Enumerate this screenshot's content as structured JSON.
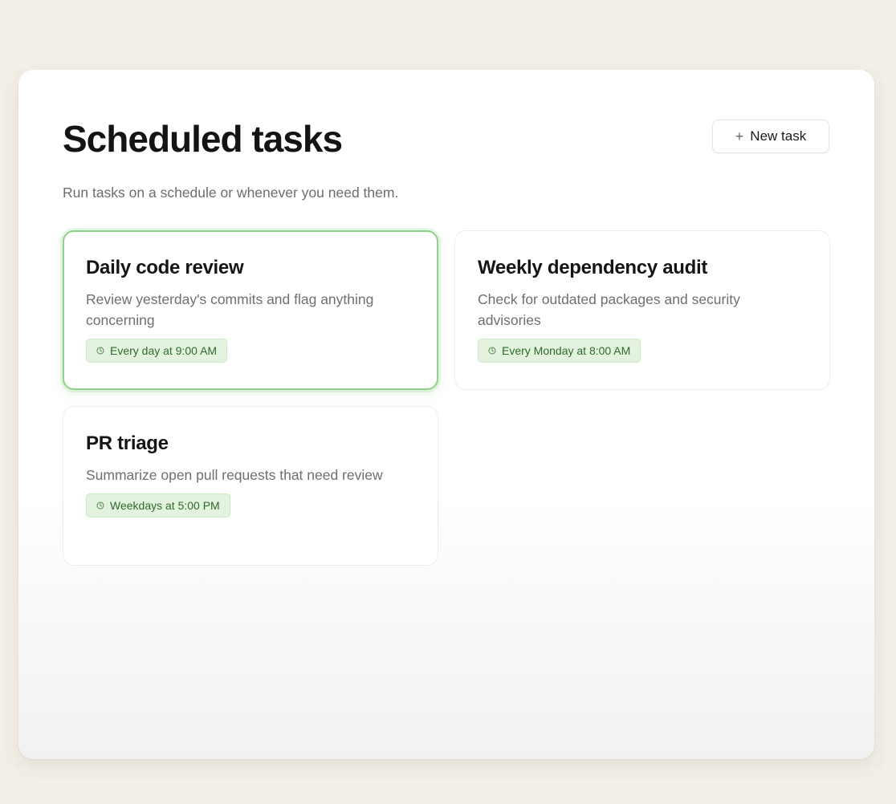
{
  "header": {
    "title": "Scheduled tasks",
    "subtitle": "Run tasks on a schedule or whenever you need them.",
    "new_task_icon": "+",
    "new_task_label": "New task"
  },
  "tasks": [
    {
      "title": "Daily code review",
      "description": "Review yesterday's commits and flag anything concerning",
      "schedule": "Every day at 9:00 AM",
      "selected": true
    },
    {
      "title": "Weekly dependency audit",
      "description": "Check for outdated packages and security advisories",
      "schedule": "Every Monday at 8:00 AM",
      "selected": false
    },
    {
      "title": "PR triage",
      "description": "Summarize open pull requests that need review",
      "schedule": "Weekdays at 5:00 PM",
      "selected": false
    }
  ],
  "icons": {
    "add": "plus-icon",
    "schedule": "clock-icon"
  },
  "colors": {
    "accent_green": "#8fd18a",
    "badge_bg": "#e3f3df",
    "badge_text": "#2f6a2b",
    "page_bg": "#f3efe7"
  }
}
